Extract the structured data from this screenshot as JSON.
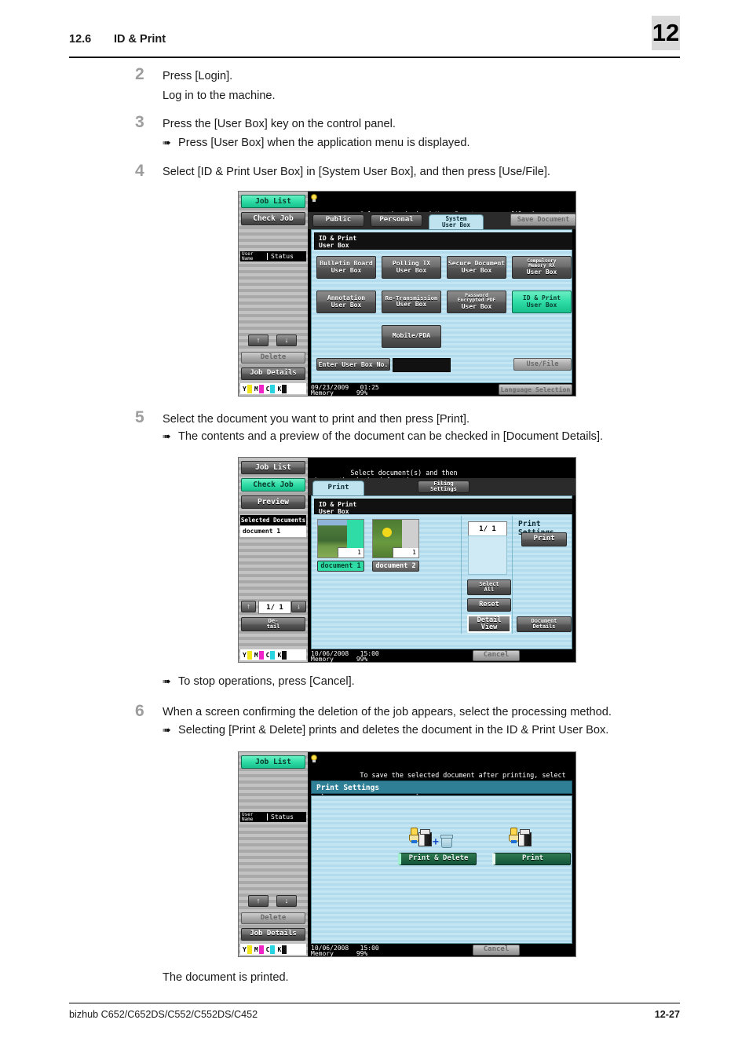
{
  "header": {
    "section_number": "12.6",
    "section_title": "ID & Print",
    "chapter_number": "12"
  },
  "steps": [
    {
      "number": "2",
      "text": "Press [Login].",
      "sub_text": "Log in to the machine."
    },
    {
      "number": "3",
      "text": "Press the [User Box] key on the control panel.",
      "bullet": "Press [User Box] when the application menu is displayed."
    },
    {
      "number": "4",
      "text": "Select [ID & Print User Box] in [System User Box], and then press [Use/File]."
    },
    {
      "number": "5",
      "text": "Select the document you want to print and then press [Print].",
      "bullet": "The contents and a preview of the document can be checked in [Document Details].",
      "bullet_after": "To stop operations, press [Cancel]."
    },
    {
      "number": "6",
      "text": "When a screen confirming the deletion of the job appears, select the processing method.",
      "bullet": "Selecting [Print & Delete] prints and deletes the document in the ID & Print User Box."
    }
  ],
  "closing_text": "The document is printed.",
  "panel1": {
    "sidebar": {
      "job_list": "Job List",
      "check_job": "Check Job",
      "user_name": "User\nName",
      "status": "Status",
      "up_arrow": "↑",
      "down_arrow": "↓",
      "delete": "Delete",
      "job_details": "Job Details",
      "toner": [
        "Y",
        "M",
        "C",
        "K"
      ]
    },
    "message": "Select the desired User Box to use or file document.\nUse the keypad to input and specify the box number to use.",
    "tabs": [
      {
        "label": "Public",
        "active": false
      },
      {
        "label": "Personal",
        "active": false
      },
      {
        "label": "System\nUser Box",
        "active": true
      }
    ],
    "save_document": "Save Document",
    "box_name": "ID & Print\nUser Box",
    "boxes": [
      {
        "line1": "Bulletin Board",
        "line2": "User Box",
        "selected": false
      },
      {
        "line1": "Polling TX",
        "line2": "User Box",
        "selected": false
      },
      {
        "line1": "Secure Document",
        "line2": "User Box",
        "selected": false
      },
      {
        "line1": "Compulsory\nMemory RX",
        "line2": "User Box",
        "selected": false
      },
      {
        "line1": "Annotation",
        "line2": "User Box",
        "selected": false
      },
      {
        "line1": "Re-Transmission",
        "line2": "User Box",
        "selected": false
      },
      {
        "line1": "Password\nEncrypted PDF",
        "line2": "User Box",
        "selected": false
      },
      {
        "line1": "ID & Print",
        "line2": "User Box",
        "selected": true
      },
      {
        "line1": "Mobile/PDA",
        "line2": "",
        "selected": false
      }
    ],
    "enter_box_no": "Enter User Box No.",
    "use_file": "Use/File",
    "status_date": "09/23/2009",
    "status_time": "01:25",
    "status_memory_label": "Memory",
    "status_memory_value": "99%",
    "language_selection": "Language Selection"
  },
  "panel2": {
    "sidebar": {
      "job_list": "Job List",
      "check_job": "Check Job",
      "preview": "Preview",
      "selected_documents": "Selected Documents",
      "doc_entry": "document 1",
      "page_indicator": "1/  1",
      "up_arrow": "↑",
      "down_arrow": "↓",
      "detail": "De-\ntail",
      "toner": [
        "Y",
        "M",
        "C",
        "K"
      ]
    },
    "message": "Select document(s) and then\nchoose the desired function.",
    "tabs": [
      {
        "label": "Print",
        "active": true
      },
      {
        "label": "Filing\nSettings",
        "active": false
      }
    ],
    "box_name": "ID & Print\nUser Box",
    "documents": [
      {
        "label": "document 1",
        "count": "1",
        "selected": true
      },
      {
        "label": "document 2",
        "count": "1",
        "selected": false
      }
    ],
    "page_counter": "1/  1",
    "print_settings_label": "Print Settings",
    "print_button": "Print",
    "select_all": "Select\nAll",
    "reset": "Reset",
    "detail_view": "Detail\nView",
    "document_details": "Document\nDetails",
    "cancel": "Cancel",
    "status_date": "10/06/2008",
    "status_time": "15:00",
    "status_memory_label": "Memory",
    "status_memory_value": "99%"
  },
  "panel3": {
    "sidebar": {
      "job_list": "Job List",
      "user_name": "User\nName",
      "status": "Status",
      "up_arrow": "↑",
      "down_arrow": "↓",
      "delete": "Delete",
      "job_details": "Job Details",
      "toner": [
        "Y",
        "M",
        "C",
        "K"
      ]
    },
    "message": "To save the selected document after printing, select\n[Print]. To delete after printing, select [Start] or\n[Print & Delete Document].",
    "title": "Print Settings",
    "print_delete_button": "Print & Delete",
    "print_button": "Print",
    "cancel": "Cancel",
    "status_date": "10/06/2008",
    "status_time": "15:00",
    "status_memory_label": "Memory",
    "status_memory_value": "99%"
  },
  "footer": {
    "model": "bizhub C652/C652DS/C552/C552DS/C452",
    "page": "12-27"
  },
  "colors": {
    "accent_green": "#2fdca5",
    "panel_blue": "#b7e0ee",
    "title_teal": "#2f7f96",
    "dark_green": "#1f6442",
    "step_number_gray": "#9d9d9d"
  }
}
